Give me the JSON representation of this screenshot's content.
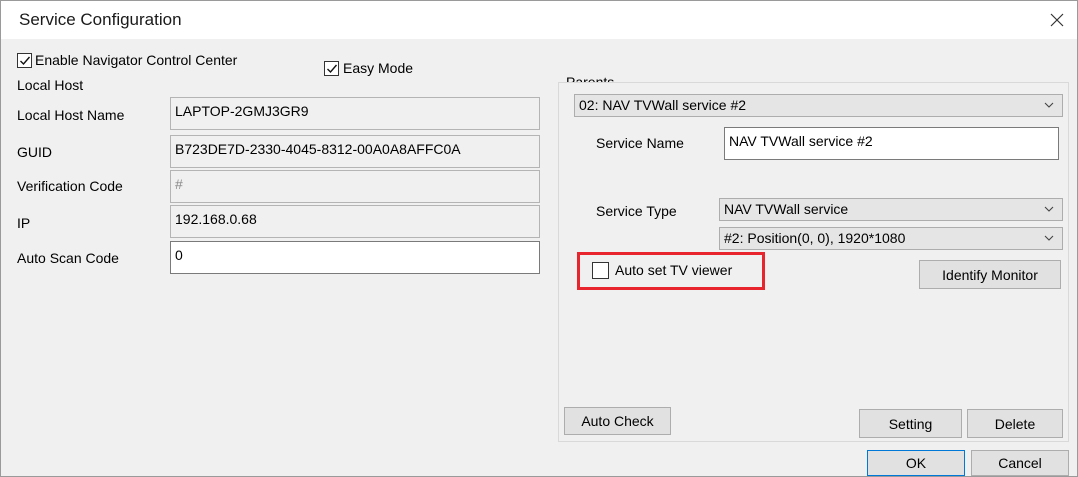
{
  "window": {
    "title": "Service Configuration"
  },
  "options": {
    "enable_navigator": {
      "label": "Enable Navigator Control Center",
      "checked": true
    },
    "easy_mode": {
      "label": "Easy Mode",
      "checked": true
    }
  },
  "local_host": {
    "group_label": "Local Host",
    "fields": {
      "host_name": {
        "label": "Local Host Name",
        "value": "LAPTOP-2GMJ3GR9"
      },
      "guid": {
        "label": "GUID",
        "value": "B723DE7D-2330-4045-8312-00A0A8AFFC0A"
      },
      "verification_code": {
        "label": "Verification Code",
        "value": "#"
      },
      "ip": {
        "label": "IP",
        "value": "192.168.0.68"
      },
      "auto_scan_code": {
        "label": "Auto Scan Code",
        "value": "0"
      }
    }
  },
  "parents": {
    "group_label": "Parents",
    "selected_parent": "02: NAV TVWall service #2",
    "service_name": {
      "label": "Service Name",
      "value": "NAV TVWall service #2"
    },
    "service_type": {
      "label": "Service Type",
      "value": "NAV TVWall service"
    },
    "monitor": "#2: Position(0, 0), 1920*1080",
    "auto_set_tv_viewer": {
      "label": "Auto set TV viewer",
      "checked": false
    },
    "identify_monitor_label": "Identify Monitor",
    "auto_check_label": "Auto Check",
    "setting_label": "Setting",
    "delete_label": "Delete"
  },
  "dialog_buttons": {
    "ok": "OK",
    "cancel": "Cancel"
  },
  "colors": {
    "highlight": "#e8242d",
    "focus": "#0078d7"
  },
  "icons": {
    "close": "close-icon",
    "dropdown": "chevron-down-icon",
    "check": "checkmark-icon"
  }
}
